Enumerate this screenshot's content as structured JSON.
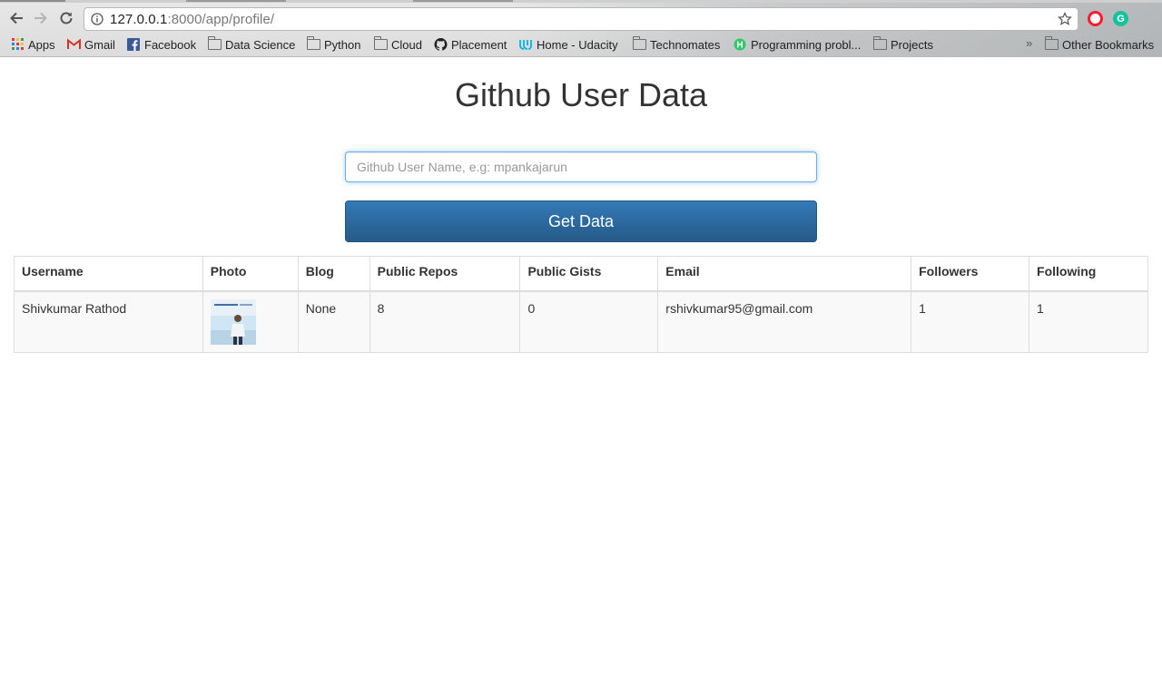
{
  "browser": {
    "url_host": "127.0.0.1",
    "url_path": ":8000/app/profile/",
    "bookmarks": [
      {
        "label": "Apps",
        "icon": "apps-grid-icon"
      },
      {
        "label": "Gmail",
        "icon": "gmail-icon"
      },
      {
        "label": "Facebook",
        "icon": "facebook-icon"
      },
      {
        "label": "Data Science",
        "icon": "folder-icon"
      },
      {
        "label": "Python",
        "icon": "folder-icon"
      },
      {
        "label": "Cloud",
        "icon": "folder-icon"
      },
      {
        "label": "Placement",
        "icon": "github-icon"
      },
      {
        "label": "Home - Udacity",
        "icon": "udacity-icon"
      },
      {
        "label": "Technomates",
        "icon": "folder-icon"
      },
      {
        "label": "Programming probl...",
        "icon": "hackerearth-icon"
      },
      {
        "label": "Projects",
        "icon": "folder-icon"
      }
    ],
    "overflow_label": "»",
    "other_bookmarks": "Other Bookmarks",
    "extension_grammarly_letter": "G"
  },
  "page": {
    "title": "Github User Data",
    "search_placeholder": "Github User Name, e.g: mpankajarun",
    "button_label": "Get Data"
  },
  "table": {
    "headers": [
      "Username",
      "Photo",
      "Blog",
      "Public Repos",
      "Public Gists",
      "Email",
      "Followers",
      "Following"
    ],
    "rows": [
      {
        "username": "Shivkumar Rathod",
        "blog": "None",
        "public_repos": "8",
        "public_gists": "0",
        "email": "rshivkumar95@gmail.com",
        "followers": "1",
        "following": "1"
      }
    ]
  },
  "colors": {
    "button": "#337ab7",
    "focus_ring": "#66afe9",
    "grammarly": "#15c39a",
    "opera": "#ff1b2d"
  }
}
